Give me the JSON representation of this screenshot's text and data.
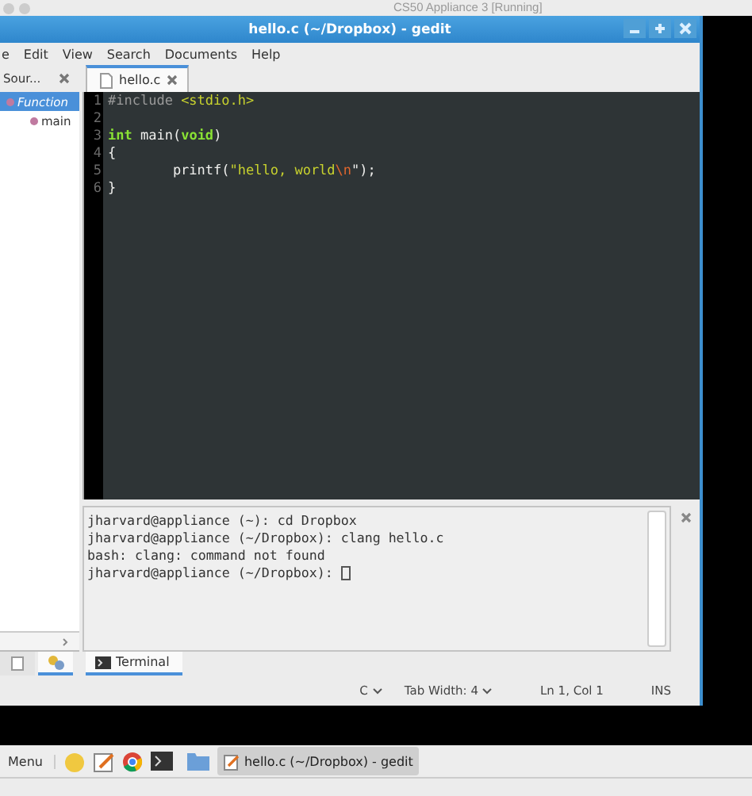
{
  "host_window": {
    "title": "CS50 Appliance 3 [Running]"
  },
  "gedit": {
    "title": "hello.c (~/Dropbox) - gedit",
    "menu": [
      "e",
      "Edit",
      "View",
      "Search",
      "Documents",
      "Help"
    ],
    "side_panel": {
      "title": "Sour...",
      "items": [
        {
          "label": "Function",
          "selected": true,
          "children": [
            {
              "label": "main",
              "selected": false
            }
          ]
        }
      ]
    },
    "document_tabs": [
      {
        "label": "hello.c",
        "selected": true
      }
    ],
    "code_lines": [
      {
        "number": "1",
        "tokens": [
          {
            "text": "#include ",
            "kind": "preproc"
          },
          {
            "text": "<stdio.h>",
            "kind": "string"
          }
        ]
      },
      {
        "number": "2"
      },
      {
        "number": "3",
        "tokens": [
          {
            "text": "int",
            "kind": "type"
          },
          {
            "text": " main(",
            "kind": "plain"
          },
          {
            "text": "void",
            "kind": "keyword"
          },
          {
            "text": ")",
            "kind": "plain"
          }
        ]
      },
      {
        "number": "4",
        "tokens": [
          {
            "text": "{",
            "kind": "plain"
          }
        ]
      },
      {
        "number": "5",
        "tokens": [
          {
            "text": "        printf(",
            "kind": "plain"
          },
          {
            "text": "\"hello, world",
            "kind": "string"
          },
          {
            "text": "\\n",
            "kind": "escape"
          },
          {
            "text": "\");",
            "kind": "plain"
          }
        ]
      },
      {
        "number": "6",
        "tokens": [
          {
            "text": "}",
            "kind": "plain"
          }
        ]
      }
    ],
    "terminal": {
      "lines": [
        "jharvard@appliance (~): cd Dropbox",
        "jharvard@appliance (~/Dropbox): clang hello.c",
        "bash: clang: command not found",
        "jharvard@appliance (~/Dropbox): "
      ],
      "tab_label": "Terminal"
    },
    "status_bar": {
      "language": "C",
      "tab_width": "Tab Width: 4",
      "position": "Ln 1, Col 1",
      "mode": "INS"
    }
  },
  "taskbar": {
    "menu_label": "Menu",
    "tasks": [
      {
        "label": "hello.c (~/Dropbox) - gedit",
        "selected": true
      }
    ]
  }
}
